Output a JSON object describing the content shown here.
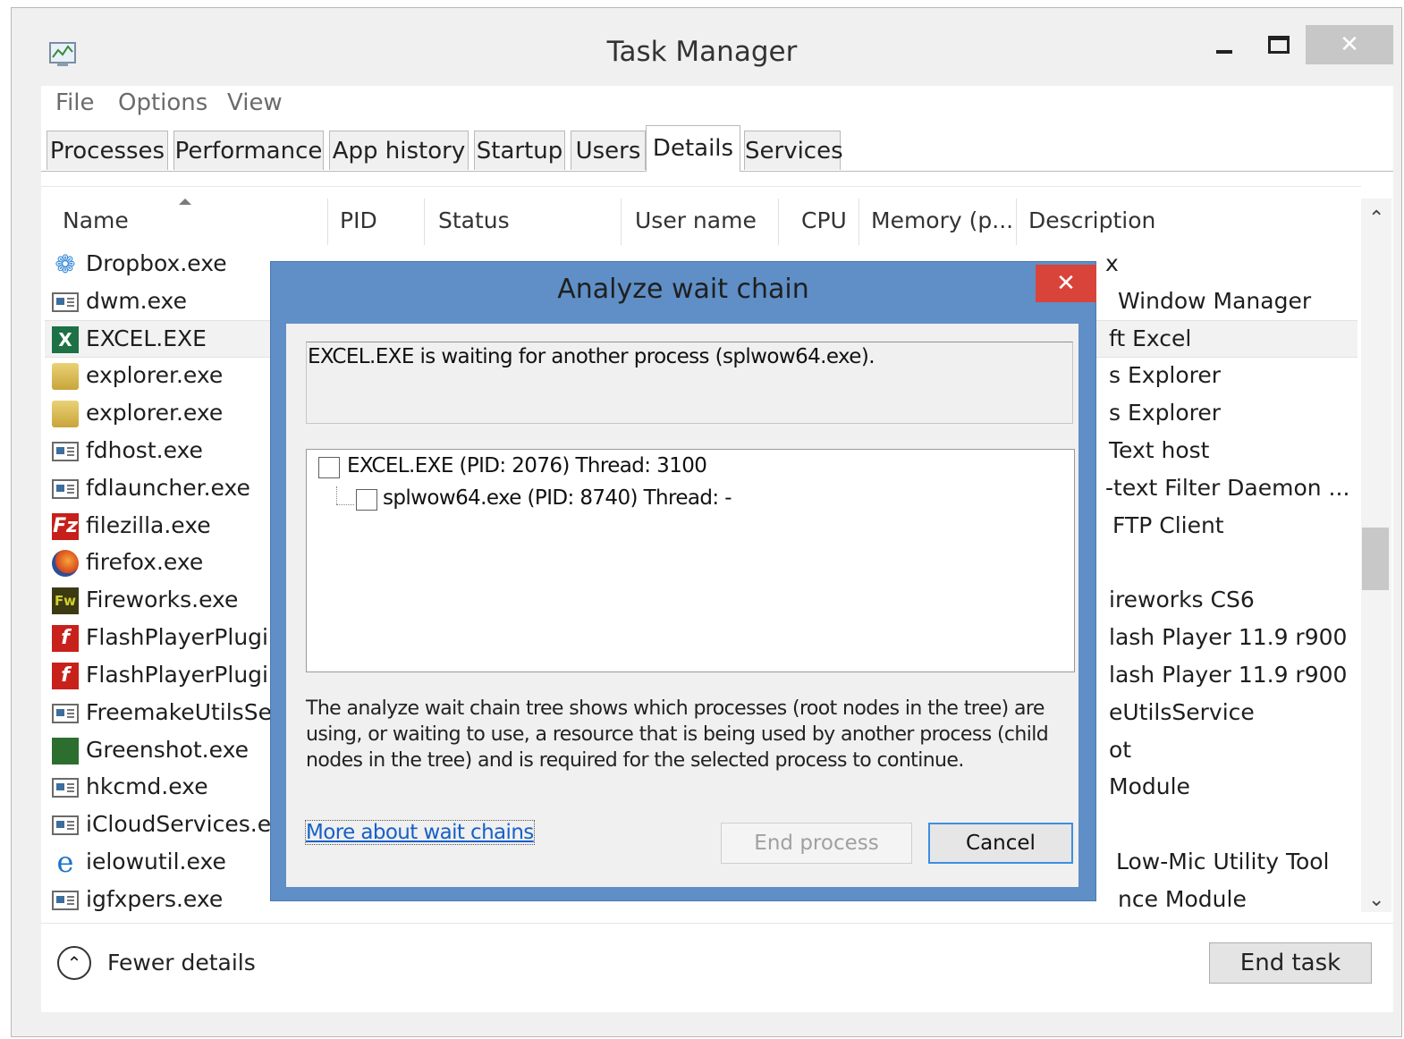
{
  "window": {
    "title": "Task Manager",
    "close_glyph": "✕"
  },
  "menu": {
    "file": "File",
    "options": "Options",
    "view": "View"
  },
  "tabs": [
    {
      "label": "Processes"
    },
    {
      "label": "Performance"
    },
    {
      "label": "App history"
    },
    {
      "label": "Startup"
    },
    {
      "label": "Users"
    },
    {
      "label": "Details",
      "active": true
    },
    {
      "label": "Services"
    }
  ],
  "columns": {
    "name": "Name",
    "pid": "PID",
    "status": "Status",
    "user": "User name",
    "cpu": "CPU",
    "memory": "Memory (p...",
    "description": "Description"
  },
  "rows": [
    {
      "name": "Dropbox.exe",
      "desc": "x",
      "icon": "dropbox-icon"
    },
    {
      "name": "dwm.exe",
      "desc": "Window Manager",
      "icon": "generic-exe-icon"
    },
    {
      "name": "EXCEL.EXE",
      "desc": "ft Excel",
      "icon": "excel-icon",
      "selected": true
    },
    {
      "name": "explorer.exe",
      "desc": "s Explorer",
      "icon": "folder-icon"
    },
    {
      "name": "explorer.exe",
      "desc": "s Explorer",
      "icon": "folder-icon"
    },
    {
      "name": "fdhost.exe",
      "desc": "Text host",
      "icon": "generic-exe-icon"
    },
    {
      "name": "fdlauncher.exe",
      "desc": "-text Filter Daemon ...",
      "icon": "generic-exe-icon"
    },
    {
      "name": "filezilla.exe",
      "desc": "FTP Client",
      "icon": "filezilla-icon"
    },
    {
      "name": "firefox.exe",
      "desc": "",
      "icon": "firefox-icon"
    },
    {
      "name": "Fireworks.exe",
      "desc": "ireworks CS6",
      "icon": "fireworks-icon"
    },
    {
      "name": "FlashPlayerPlugin",
      "desc": "lash Player 11.9 r900",
      "icon": "flash-icon"
    },
    {
      "name": "FlashPlayerPlugin",
      "desc": "lash Player 11.9 r900",
      "icon": "flash-icon"
    },
    {
      "name": "FreemakeUtilsSer",
      "desc": "eUtilsService",
      "icon": "generic-exe-icon"
    },
    {
      "name": "Greenshot.exe",
      "desc": "ot",
      "icon": "greenshot-icon"
    },
    {
      "name": "hkcmd.exe",
      "desc": "Module",
      "icon": "generic-exe-icon"
    },
    {
      "name": "iCloudServices.ex",
      "desc": "",
      "icon": "generic-exe-icon"
    },
    {
      "name": "ielowutil.exe",
      "desc": "Low-Mic Utility Tool",
      "icon": "ie-icon"
    },
    {
      "name": "igfxpers.exe",
      "desc": "nce Module",
      "icon": "generic-exe-icon"
    }
  ],
  "footer": {
    "fewer_details": "Fewer details",
    "end_task": "End task"
  },
  "dialog": {
    "title": "Analyze wait chain",
    "close_glyph": "✕",
    "message": "EXCEL.EXE is waiting for another process (splwow64.exe).",
    "tree": [
      {
        "label": "EXCEL.EXE (PID: 2076) Thread: 3100",
        "checked": false
      },
      {
        "label": "splwow64.exe (PID: 8740) Thread: -",
        "checked": false
      }
    ],
    "description": "The analyze wait chain tree shows which processes (root nodes in the tree) are using, or waiting to use, a resource that is being used by another process (child nodes in the tree) and is required for the selected process to continue.",
    "link": "More about wait chains",
    "end_process": "End process",
    "cancel": "Cancel"
  },
  "colors": {
    "dialog_frame": "#5f8fc6",
    "dialog_close": "#d9443a",
    "link": "#1660c8",
    "focus_border": "#3c8ee0"
  }
}
